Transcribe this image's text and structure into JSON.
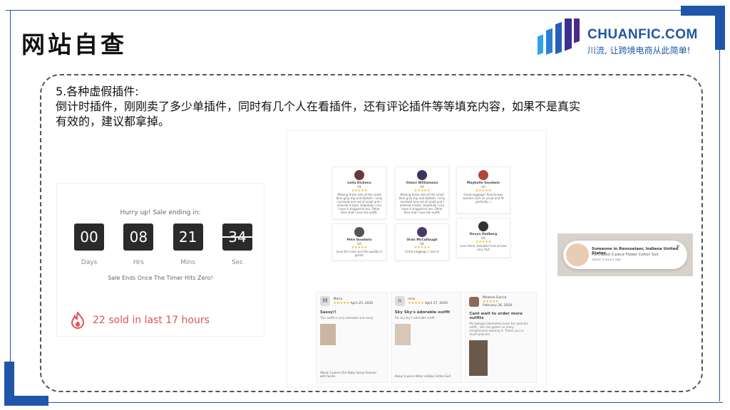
{
  "slide": {
    "title": "网站自查",
    "brand": "CHUANFIC.COM",
    "slogan": "川流, 让跨境电商从此简单!",
    "heading_line1": "5.各种虚假插件:",
    "heading_line2": "倒计时插件，刚刚卖了多少单插件，同时有几个人在看插件，还有评论插件等等填充内容，如果不是真实",
    "heading_line3": "有效的，建议都拿掉。",
    "accent_color": "#1f56a8"
  },
  "countdown": {
    "hurry": "Hurry up! Sale ending in:",
    "digits": [
      "00",
      "08",
      "21",
      "34"
    ],
    "units": [
      "Days",
      "Hrs",
      "Mins",
      "Sec"
    ],
    "ends": "Sale Ends Once The Timer Hits Zero!",
    "sold": "22 sold in last 17 hours"
  },
  "reviews_grid": [
    {
      "name": "Leila Dickens",
      "flag": "US",
      "text": "Missing three sets of the small blue gray top and bottom. I only received one set of small and I ordered 4 total. Hopefully I can have it shipped to me. Other then that I love the outfit."
    },
    {
      "name": "Omari Williamson",
      "flag": "US",
      "text": "Missing three sets of the small blue gray top and bottom. I only received one set of small and I ordered 4 total. Hopefully I can have it shipped to me. Other then that I love the outfit."
    },
    {
      "name": "Maybelle Goodwin",
      "flag": "US",
      "text": "Great leggings! Rominnows women such as usual and fit perfectly :)"
    },
    {
      "name": "Pete Goodwin",
      "flag": "US",
      "text": "Love the color and the quality is great!"
    },
    {
      "name": "Oran McCullough",
      "flag": "UK",
      "text": "Great Leggings, I love it"
    },
    {
      "name": "Devyn Padberg",
      "flag": "US",
      "text": "Love them, beautiful and arrived very fast"
    }
  ],
  "reviews_bottom": [
    {
      "initial": "M",
      "name": "Maria",
      "date": "April 25, 2020",
      "title": "Sassy!!",
      "body": "This outfit is very adorable and sassy",
      "about": "About  3-piece Chic Baby Sassy Onesies with Socks"
    },
    {
      "initial": "n",
      "name": "nina",
      "date": "April 27, 2020",
      "title": "Sky Sky's adorable outfit",
      "body": "For sky sky's adorable outfit",
      "about": "About  3-piece What a Babe Cotton Suit"
    },
    {
      "initial": "",
      "name": "Melanie Garcia",
      "date": "February 26, 2020",
      "title": "Cant wait to order more outfits",
      "body": "My babygirl absolutely loves her peanuts outfit.. she has gotten so many compliments wearing it. Thank you so much peanuts",
      "about": ""
    }
  ],
  "social_proof": {
    "line1": "Someone in Rensselaer, Indiana United States",
    "line2": "Purchased 3-piece Flower Cotton Suit",
    "line3": "about 3 hours ago",
    "close": "×"
  }
}
